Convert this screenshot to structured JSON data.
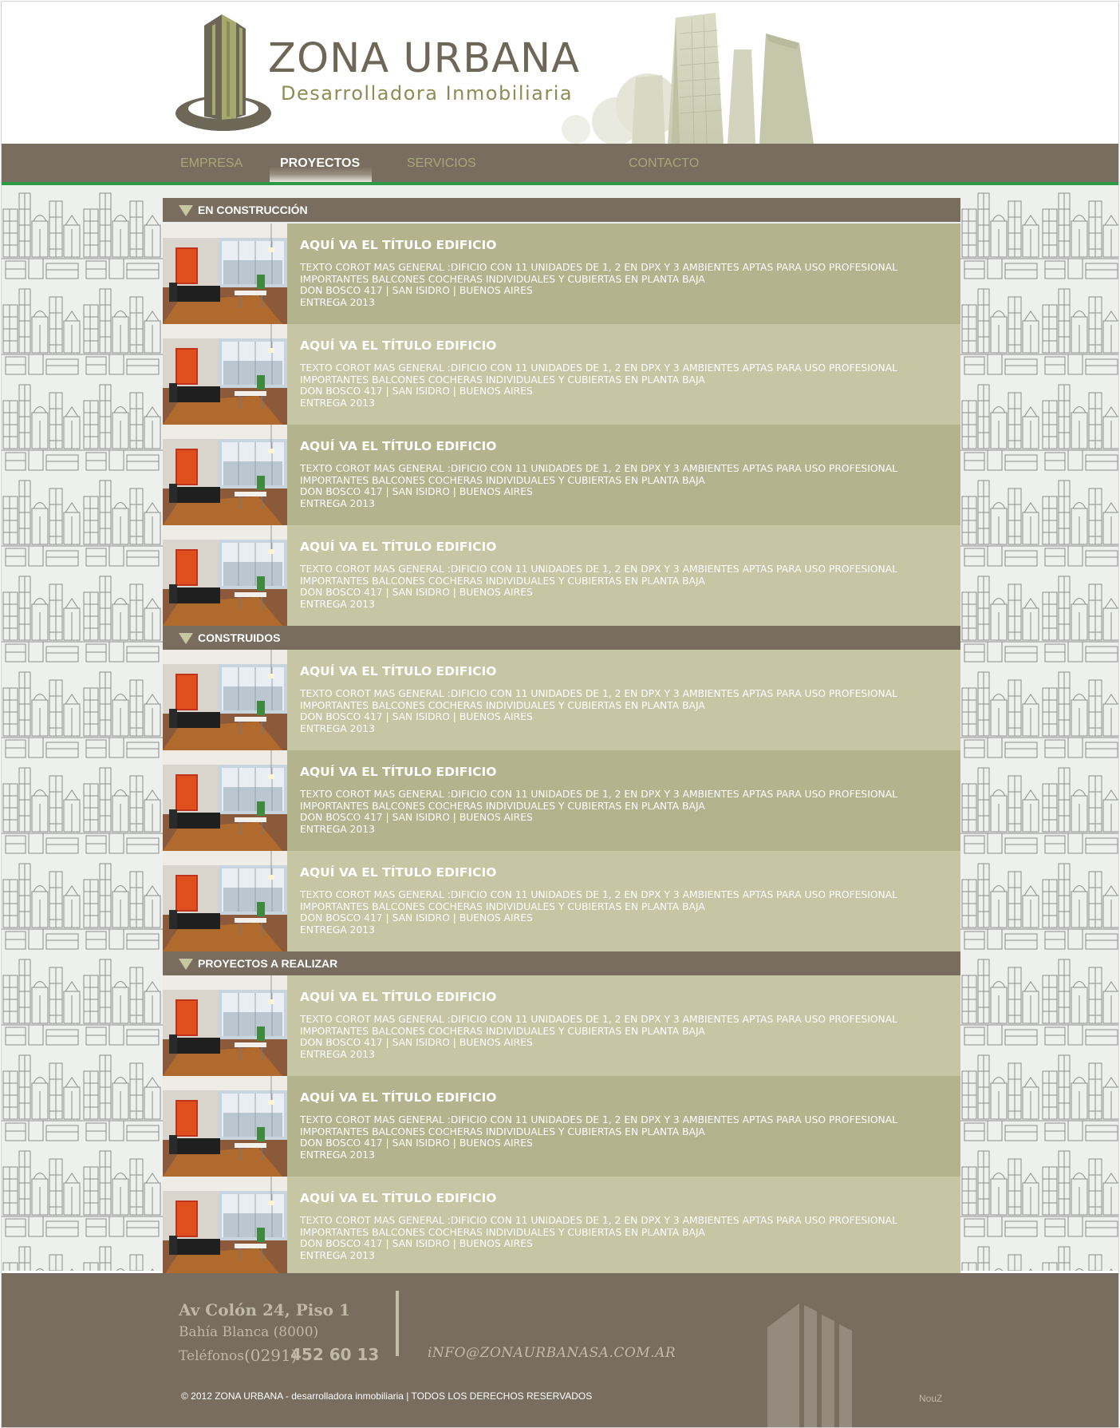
{
  "brand": {
    "name": "ZONA URBANA",
    "tagline": "Desarrolladora Inmobiliaria"
  },
  "nav": {
    "items": [
      {
        "label": "EMPRESA",
        "active": false
      },
      {
        "label": "PROYECTOS",
        "active": true
      },
      {
        "label": "SERVICIOS",
        "active": false
      },
      {
        "label": "CONTACTO",
        "active": false
      }
    ]
  },
  "colors": {
    "nav_bg": "#786d5f",
    "accent_green": "#2c9a45",
    "row_dark": "#b3b38e",
    "row_light": "#c6c6a4"
  },
  "sections": [
    {
      "title": "EN CONSTRUCCIÓN",
      "items": [
        {
          "title": "AQUÍ VA EL TÍTULO EDIFICIO",
          "line1": "TEXTO COROT MAS GENERAL :DIFICIO CON 11 UNIDADES DE 1, 2 EN DPX Y 3 AMBIENTES APTAS PARA USO PROFESIONAL",
          "line2": "IMPORTANTES BALCONES COCHERAS INDIVIDUALES Y CUBIERTAS EN PLANTA BAJA",
          "address": "DON BOSCO 417 | SAN ISIDRO | BUENOS AIRES",
          "delivery": "ENTREGA 2013"
        },
        {
          "title": "AQUÍ VA EL TÍTULO EDIFICIO",
          "line1": "TEXTO COROT MAS GENERAL :DIFICIO CON 11 UNIDADES DE 1, 2 EN DPX Y 3 AMBIENTES APTAS PARA USO PROFESIONAL",
          "line2": "IMPORTANTES BALCONES COCHERAS INDIVIDUALES Y CUBIERTAS EN PLANTA BAJA",
          "address": "DON BOSCO 417 | SAN ISIDRO | BUENOS AIRES",
          "delivery": "ENTREGA 2013"
        },
        {
          "title": "AQUÍ VA EL TÍTULO EDIFICIO",
          "line1": "TEXTO COROT MAS GENERAL :DIFICIO CON 11 UNIDADES DE 1, 2 EN DPX Y 3 AMBIENTES APTAS PARA USO PROFESIONAL",
          "line2": "IMPORTANTES BALCONES COCHERAS INDIVIDUALES Y CUBIERTAS EN PLANTA BAJA",
          "address": "DON BOSCO 417 | SAN ISIDRO | BUENOS AIRES",
          "delivery": "ENTREGA 2013"
        },
        {
          "title": "AQUÍ VA EL TÍTULO EDIFICIO",
          "line1": "TEXTO COROT MAS GENERAL :DIFICIO CON 11 UNIDADES DE 1, 2 EN DPX Y 3 AMBIENTES APTAS PARA USO PROFESIONAL",
          "line2": "IMPORTANTES BALCONES COCHERAS INDIVIDUALES Y CUBIERTAS EN PLANTA BAJA",
          "address": "DON BOSCO 417 | SAN ISIDRO | BUENOS AIRES",
          "delivery": "ENTREGA 2013"
        }
      ]
    },
    {
      "title": "CONSTRUIDOS",
      "items": [
        {
          "title": "AQUÍ VA EL TÍTULO EDIFICIO",
          "line1": "TEXTO COROT MAS GENERAL :DIFICIO CON 11 UNIDADES DE 1, 2 EN DPX Y 3 AMBIENTES APTAS PARA USO PROFESIONAL",
          "line2": "IMPORTANTES BALCONES COCHERAS INDIVIDUALES Y CUBIERTAS EN PLANTA BAJA",
          "address": "DON BOSCO 417 | SAN ISIDRO | BUENOS AIRES",
          "delivery": "ENTREGA 2013"
        },
        {
          "title": "AQUÍ VA EL TÍTULO EDIFICIO",
          "line1": "TEXTO COROT MAS GENERAL :DIFICIO CON 11 UNIDADES DE 1, 2 EN DPX Y 3 AMBIENTES APTAS PARA USO PROFESIONAL",
          "line2": "IMPORTANTES BALCONES COCHERAS INDIVIDUALES Y CUBIERTAS EN PLANTA BAJA",
          "address": "DON BOSCO 417 | SAN ISIDRO | BUENOS AIRES",
          "delivery": "ENTREGA 2013"
        },
        {
          "title": "AQUÍ VA EL TÍTULO EDIFICIO",
          "line1": "TEXTO COROT MAS GENERAL :DIFICIO CON 11 UNIDADES DE 1, 2 EN DPX Y 3 AMBIENTES APTAS PARA USO PROFESIONAL",
          "line2": "IMPORTANTES BALCONES COCHERAS INDIVIDUALES Y CUBIERTAS EN PLANTA BAJA",
          "address": "DON BOSCO 417 | SAN ISIDRO | BUENOS AIRES",
          "delivery": "ENTREGA 2013"
        }
      ]
    },
    {
      "title": "PROYECTOS A REALIZAR",
      "items": [
        {
          "title": "AQUÍ VA EL TÍTULO EDIFICIO",
          "line1": "TEXTO COROT MAS GENERAL :DIFICIO CON 11 UNIDADES DE 1, 2 EN DPX Y 3 AMBIENTES APTAS PARA USO PROFESIONAL",
          "line2": "IMPORTANTES BALCONES COCHERAS INDIVIDUALES Y CUBIERTAS EN PLANTA BAJA",
          "address": "DON BOSCO 417 | SAN ISIDRO | BUENOS AIRES",
          "delivery": "ENTREGA 2013"
        },
        {
          "title": "AQUÍ VA EL TÍTULO EDIFICIO",
          "line1": "TEXTO COROT MAS GENERAL :DIFICIO CON 11 UNIDADES DE 1, 2 EN DPX Y 3 AMBIENTES APTAS PARA USO PROFESIONAL",
          "line2": "IMPORTANTES BALCONES COCHERAS INDIVIDUALES Y CUBIERTAS EN PLANTA BAJA",
          "address": "DON BOSCO 417 | SAN ISIDRO | BUENOS AIRES",
          "delivery": "ENTREGA 2013"
        },
        {
          "title": "AQUÍ VA EL TÍTULO EDIFICIO",
          "line1": "TEXTO COROT MAS GENERAL :DIFICIO CON 11 UNIDADES DE 1, 2 EN DPX Y 3 AMBIENTES APTAS PARA USO PROFESIONAL",
          "line2": "IMPORTANTES BALCONES COCHERAS INDIVIDUALES Y CUBIERTAS EN PLANTA BAJA",
          "address": "DON BOSCO 417 | SAN ISIDRO | BUENOS AIRES",
          "delivery": "ENTREGA 2013"
        }
      ]
    }
  ],
  "footer": {
    "address_line1": "Av Colón 24, Piso 1",
    "address_line2": "Bahía Blanca (8000)",
    "phone_label": "Teléfonos:",
    "phone_area": "(0291)",
    "phone_number": "452 60 13",
    "email": "iNFO@ZONAURBANASA.COM.AR",
    "copyright": "© 2012 ZONA URBANA - desarrolladora inmobiliaria | TODOS LOS DERECHOS RESERVADOS",
    "credit": "NouZ"
  },
  "icons": [
    "building-logo-icon",
    "section-triangle-icon",
    "footer-building-icon"
  ]
}
